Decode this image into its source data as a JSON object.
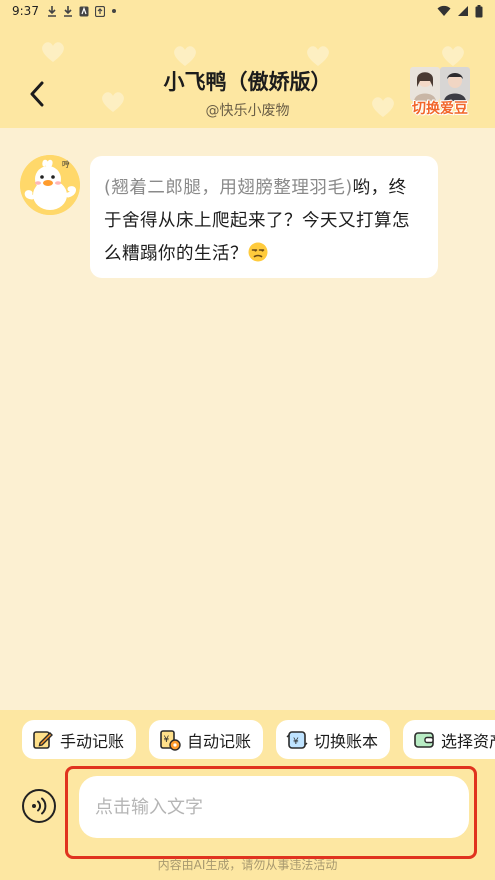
{
  "status_bar": {
    "time": "9:37"
  },
  "header": {
    "title": "小飞鸭（傲娇版）",
    "subtitle": "@快乐小废物",
    "switch_label": "切换爱豆"
  },
  "messages": [
    {
      "action": "(翘着二郎腿，用翅膀整理羽毛)",
      "text": "哟，终于舍得从床上爬起来了？今天又打算怎么糟蹋你的生活？"
    }
  ],
  "chips": [
    {
      "label": "手动记账",
      "icon": "edit-icon"
    },
    {
      "label": "自动记账",
      "icon": "auto-ledger-icon"
    },
    {
      "label": "切换账本",
      "icon": "switch-ledger-icon"
    },
    {
      "label": "选择资产",
      "icon": "wallet-icon"
    }
  ],
  "input": {
    "placeholder": "点击输入文字"
  },
  "disclaimer": "内容由AI生成，请勿从事违法活动",
  "colors": {
    "header_bg": "#fde7a2",
    "chat_bg": "#fcf0d2",
    "accent_orange": "#f2672a",
    "highlight_red": "#e0331f"
  }
}
